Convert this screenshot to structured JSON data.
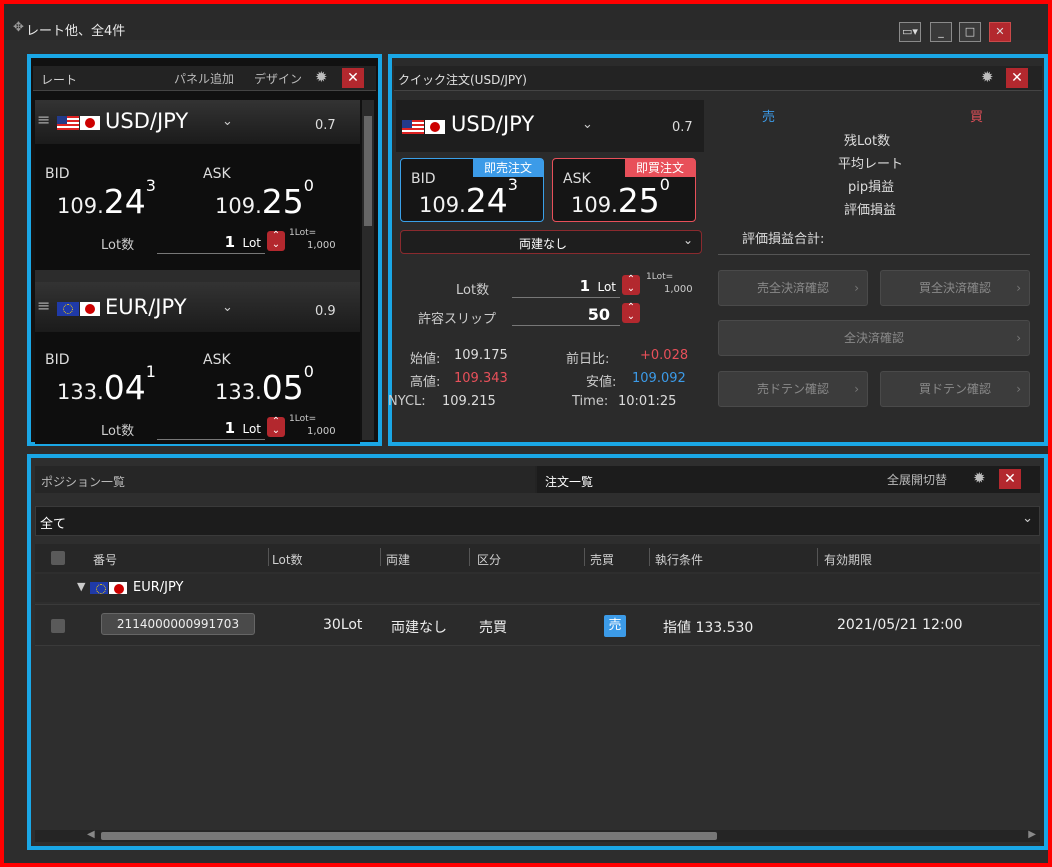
{
  "window": {
    "title": "レート他、全4件",
    "controls": [
      "▭▾",
      "_",
      "□",
      "✕"
    ]
  },
  "rate_panel": {
    "title": "レート",
    "add_panel": "パネル追加",
    "design": "デザイン",
    "pairs": [
      {
        "symbol": "USD/JPY",
        "spread": "0.7",
        "bid_label": "BID",
        "ask_label": "ASK",
        "bid_main": "109.",
        "bid_big": "24",
        "bid_sup": "3",
        "ask_main": "109.",
        "ask_big": "25",
        "ask_sup": "0",
        "lot_label": "Lot数",
        "lot_value": "1",
        "lot_unit": "Lot",
        "lot_note1": "1Lot=",
        "lot_note2": "1,000"
      },
      {
        "symbol": "EUR/JPY",
        "spread": "0.9",
        "bid_label": "BID",
        "ask_label": "ASK",
        "bid_main": "133.",
        "bid_big": "04",
        "bid_sup": "1",
        "ask_main": "133.",
        "ask_big": "05",
        "ask_sup": "0",
        "lot_label": "Lot数",
        "lot_value": "1",
        "lot_unit": "Lot",
        "lot_note1": "1Lot=",
        "lot_note2": "1,000"
      }
    ]
  },
  "quick_order": {
    "title": "クイック注文(USD/JPY)",
    "symbol": "USD/JPY",
    "spread": "0.7",
    "bid_label": "BID",
    "bid_tag": "即売注文",
    "bid_main": "109.",
    "bid_big": "24",
    "bid_sup": "3",
    "ask_label": "ASK",
    "ask_tag": "即買注文",
    "ask_main": "109.",
    "ask_big": "25",
    "ask_sup": "0",
    "hedge_select": "両建なし",
    "lot_label": "Lot数",
    "lot_value": "1",
    "lot_unit": "Lot",
    "lot_note1": "1Lot=",
    "lot_note2": "1,000",
    "slip_label": "許容スリップ",
    "slip_value": "50",
    "open_label": "始値:",
    "open_value": "109.175",
    "prev_label": "前日比:",
    "prev_value": "+0.028",
    "high_label": "高値:",
    "high_value": "109.343",
    "low_label": "安値:",
    "low_value": "109.092",
    "nycl_label": "NYCL:",
    "nycl_value": "109.215",
    "time_label": "Time:",
    "time_value": "10:01:25",
    "sell_label": "売",
    "buy_label": "買",
    "stats": [
      "残Lot数",
      "平均レート",
      "pip損益",
      "評価損益"
    ],
    "total_label": "評価損益合計:",
    "buttons": {
      "sell_all": "売全決済確認",
      "buy_all": "買全決済確認",
      "all": "全決済確認",
      "sell_doten": "売ドテン確認",
      "buy_doten": "買ドテン確認"
    }
  },
  "bottom": {
    "tab_positions": "ポジション一覧",
    "tab_orders": "注文一覧",
    "expand_toggle": "全展開切替",
    "filter": "全て",
    "columns": [
      "番号",
      "Lot数",
      "両建",
      "区分",
      "売買",
      "執行条件",
      "有効期限"
    ],
    "group": "EUR/JPY",
    "row": {
      "id": "2114000000991703",
      "lot": "30Lot",
      "hedge": "両建なし",
      "kind": "売買",
      "side": "売",
      "condition": "指値 133.530",
      "expiry": "2021/05/21 12:00"
    }
  },
  "colors": {
    "highlight": "#1aa7e6",
    "frame": "#ff0000",
    "sell": "#3c9be8",
    "buy": "#e8505a"
  }
}
